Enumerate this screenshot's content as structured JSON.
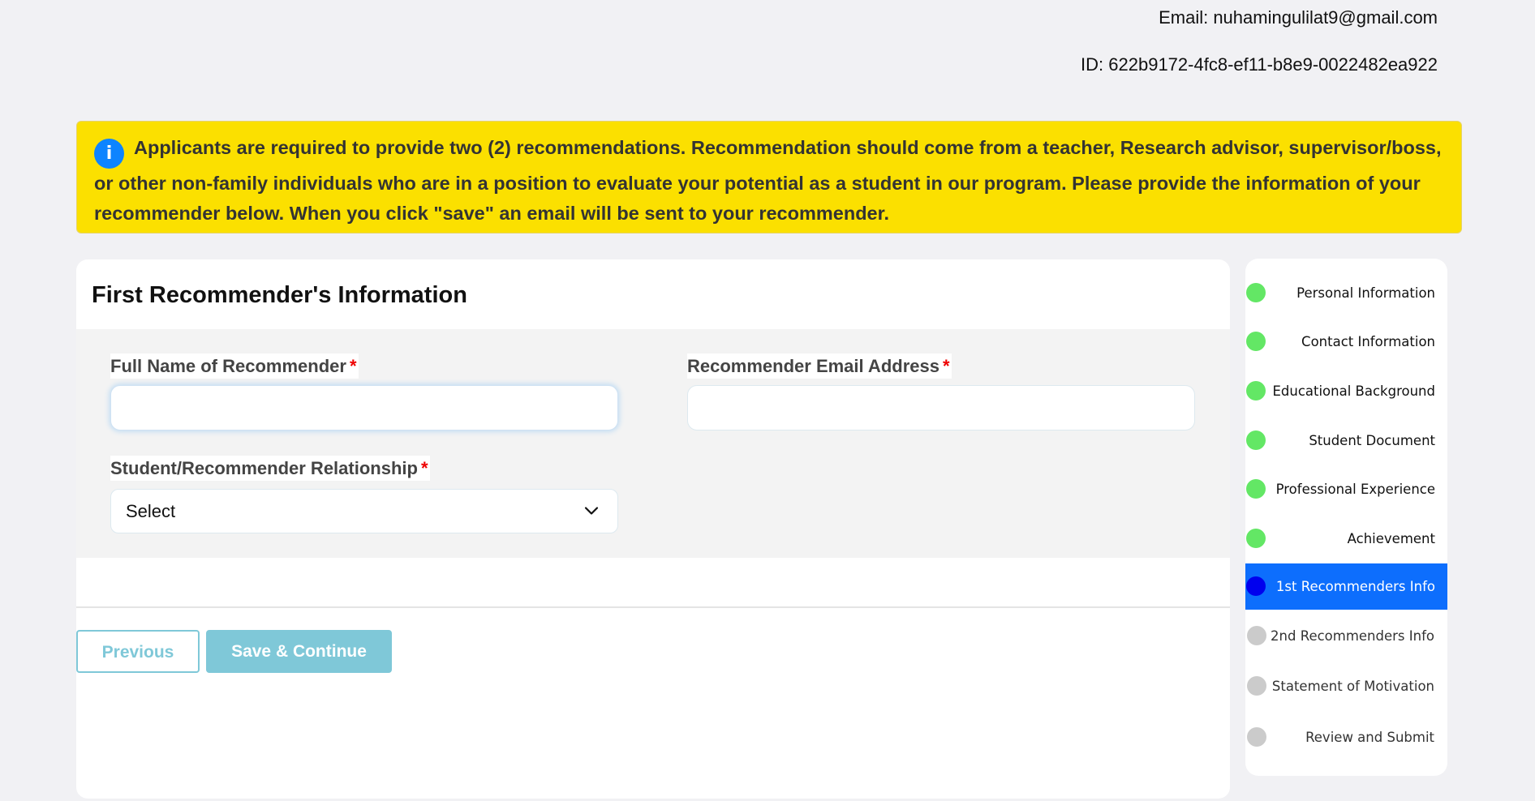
{
  "user": {
    "email_line": "Email: nuhamingulilat9@gmail.com",
    "id_line": "ID: 622b9172-4fc8-ef11-b8e9-0022482ea922"
  },
  "banner": {
    "icon": "info-icon",
    "icon_glyph": "i",
    "text": "Applicants are required to provide two (2) recommendations. Recommendation should come from a teacher, Research advisor, supervisor/boss, or other non-family individuals who are in a position to evaluate your potential as a student in our program. Please provide the information of your recommender below. When you click \"save\" an email will be sent to your recommender.",
    "background_color": "#fbe000"
  },
  "form": {
    "title": "First Recommender's Information",
    "required_mark": "*",
    "fields": {
      "full_name": {
        "label": "Full Name of Recommender",
        "value": "",
        "placeholder": ""
      },
      "email": {
        "label": "Recommender Email Address",
        "value": "",
        "placeholder": ""
      },
      "relationship": {
        "label": "Student/Recommender Relationship",
        "selected": "Select"
      }
    },
    "buttons": {
      "previous": "Previous",
      "save": "Save & Continue"
    },
    "button_color": "#7fc8d8"
  },
  "sidebar": {
    "active_color": "#0d6efd",
    "steps": [
      {
        "label": "Personal Information",
        "status": "done"
      },
      {
        "label": "Contact Information",
        "status": "done"
      },
      {
        "label": "Educational Background",
        "status": "done"
      },
      {
        "label": "Student Document",
        "status": "done"
      },
      {
        "label": "Professional Experience",
        "status": "done"
      },
      {
        "label": "Achievement",
        "status": "done"
      },
      {
        "label": "1st Recommenders Info",
        "status": "active"
      },
      {
        "label": "2nd Recommenders Info",
        "status": "pending"
      },
      {
        "label": "Statement of Motivation",
        "status": "pending"
      },
      {
        "label": "Review and Submit",
        "status": "pending"
      }
    ]
  }
}
